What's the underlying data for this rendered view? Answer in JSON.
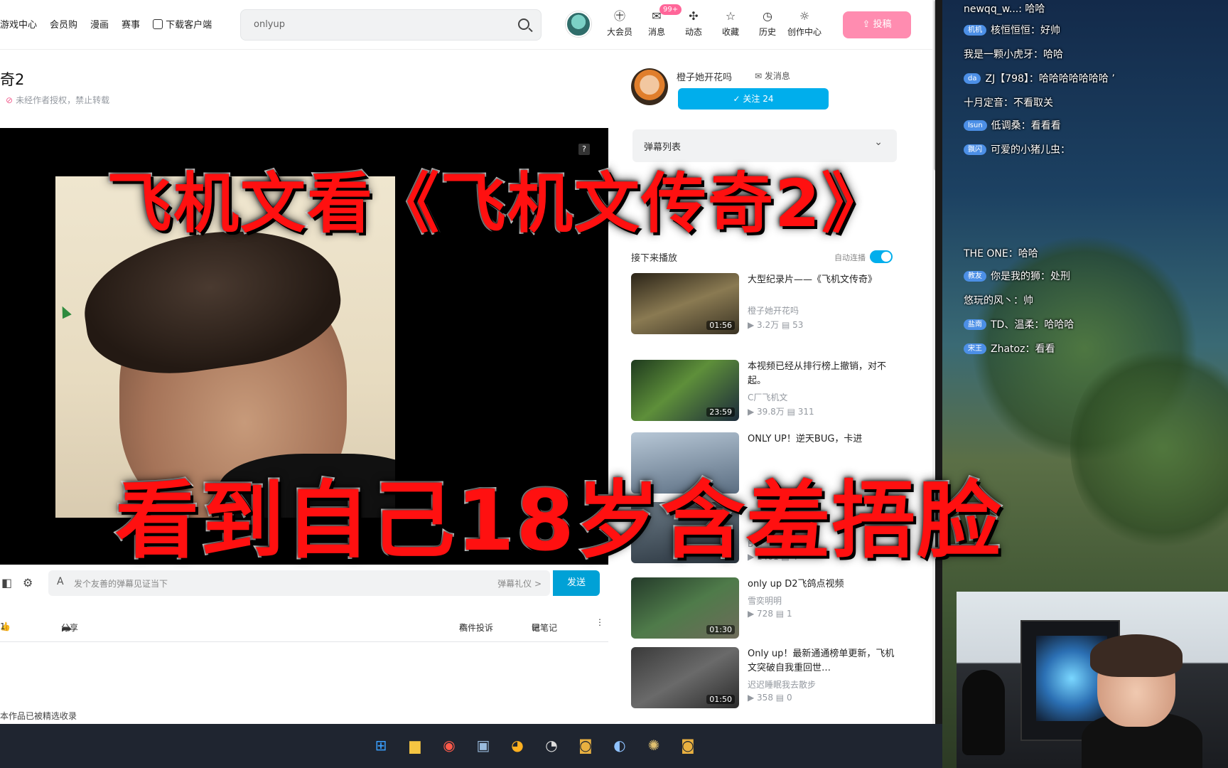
{
  "page": {
    "nav": [
      "游戏中心",
      "会员购",
      "漫画",
      "赛事",
      "下载客户端"
    ],
    "search": {
      "query": "onlyup",
      "icon": "search-icon"
    },
    "toolbar": [
      {
        "label": "大会员",
        "icon": "vip-icon"
      },
      {
        "label": "消息",
        "icon": "message-icon",
        "badge": "99+"
      },
      {
        "label": "动态",
        "icon": "feed-icon"
      },
      {
        "label": "收藏",
        "icon": "star-icon"
      },
      {
        "label": "历史",
        "icon": "clock-icon"
      },
      {
        "label": "创作中心",
        "icon": "bulb-icon"
      }
    ],
    "upload_label": "投稿",
    "video_title": "奇2",
    "copyright": "未经作者授权，禁止转载",
    "danmaku_bar": {
      "placeholder": "发个友善的弹幕见证当下",
      "etiquette": "弹幕礼仪 >",
      "send": "发送"
    },
    "actions": {
      "like_count": "1",
      "share": "分享",
      "report": "稿件投诉",
      "notes": "记笔记"
    },
    "bottom_text": "本作品已被精选收录"
  },
  "uploader": {
    "name": "橙子她开花吗",
    "message": "发消息",
    "follow": "✓ 关注 24"
  },
  "danmaku_list": {
    "title": "弹幕列表"
  },
  "autoplay": {
    "label": "接下来播放",
    "toggle_label": "自动连播",
    "on": true
  },
  "recommendations": [
    {
      "title": "大型纪录片——《飞机文传奇》",
      "author": "橙子她开花吗",
      "views": "3.2万",
      "danmaku": "53",
      "duration": "01:56"
    },
    {
      "title": "本视频已经从排行榜上撤销，对不起。",
      "author": "C厂飞机文",
      "views": "39.8万",
      "danmaku": "311",
      "duration": "23:59"
    },
    {
      "title": "ONLY UP！逆天BUG，卡进",
      "author": "",
      "views": "",
      "danmaku": "",
      "duration": ""
    },
    {
      "title": "",
      "author": "B不",
      "views": "1401",
      "danmaku": "4",
      "duration": ""
    },
    {
      "title": "only up D2飞鸽点视频",
      "author": "雪奕明明",
      "views": "728",
      "danmaku": "1",
      "duration": "01:30"
    },
    {
      "title": "Only up！最新通通榜单更新，飞机文突破自我重回世…",
      "author": "迟迟睡眠我去散步",
      "views": "358",
      "danmaku": "0",
      "duration": "01:50"
    }
  ],
  "stream_chat": [
    {
      "badge": "",
      "text": "newqq_w...: 哈哈"
    },
    {
      "badge": "机机",
      "text": "核恒恒恒：好帅"
    },
    {
      "badge": "",
      "text": "我是一颗小虎牙：哈哈"
    },
    {
      "badge": "da",
      "text": "ZJ【798】：哈哈哈哈哈哈哈 ’"
    },
    {
      "badge": "",
      "text": "十月定音：不看取关"
    },
    {
      "badge": "lsun",
      "text": "低调桑：看看看"
    },
    {
      "badge": "飘闪",
      "text": "可爱的小猪儿虫："
    },
    {
      "badge": "",
      "text": "THE ONE：哈哈"
    },
    {
      "badge": "教友",
      "text": "你是我的狮：处刑"
    },
    {
      "badge": "",
      "text": "悠玩的风丶：帅"
    },
    {
      "badge": "盐南",
      "text": "TD、温柔：哈哈哈"
    },
    {
      "badge": "宋王",
      "text": "Zhatoz：看看"
    }
  ],
  "captions": {
    "line1": "飞机文看《飞机文传奇2》",
    "line2": "看到自己18岁含羞捂脸"
  },
  "colors": {
    "accent": "#00aeec",
    "upload": "#ff8cb0",
    "caption": "#ff1010",
    "badge": "#ff6699"
  }
}
